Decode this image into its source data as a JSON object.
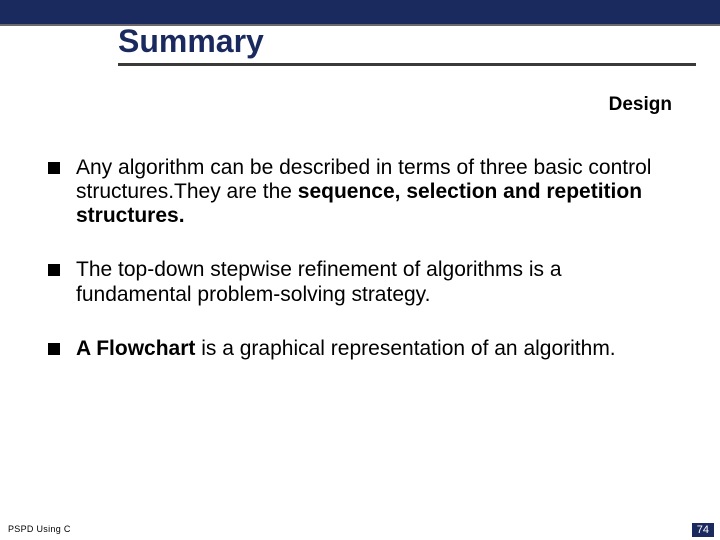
{
  "title": "Summary",
  "design_label": "Design",
  "bullets": [
    {
      "pre": "Any algorithm can be described in terms of three basic control structures.They are the ",
      "bold": "sequence, selection and repetition structures.",
      "post": ""
    },
    {
      "pre": "The top-down stepwise refinement of algorithms is a fundamental problem-solving strategy.",
      "bold": "",
      "post": ""
    },
    {
      "pre": "",
      "bold": "A Flowchart",
      "post": " is a graphical  representation  of an algorithm."
    }
  ],
  "footer_left": "PSPD Using C",
  "footer_right": "74"
}
